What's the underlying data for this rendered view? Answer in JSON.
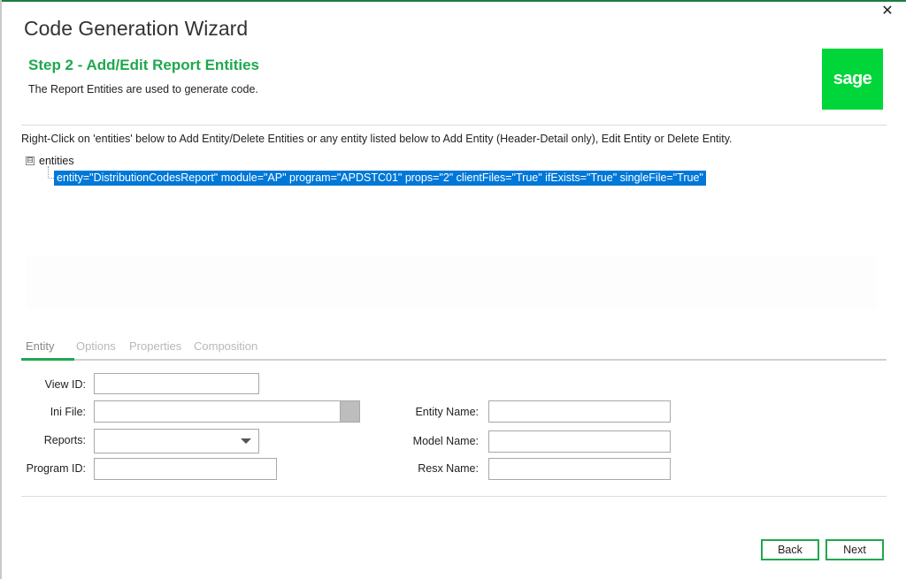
{
  "window": {
    "title": "Code Generation Wizard",
    "close_label": "✕"
  },
  "step": {
    "title": "Step  2 - Add/Edit Report Entities",
    "description": "The Report Entities are used to generate code."
  },
  "logo": {
    "text": "sage",
    "color": "#00d639"
  },
  "instruction": "Right-Click on 'entities' below to Add Entity/Delete Entities or any entity listed below to Add Entity (Header-Detail only), Edit Entity or Delete Entity.",
  "tree": {
    "expander": "⊟",
    "root_label": "entities",
    "nodes": [
      {
        "label": "entity=\"DistributionCodesReport\" module=\"AP\" program=\"APDSTC01\" props=\"2\" clientFiles=\"True\" ifExists=\"True\" singleFile=\"True\""
      }
    ]
  },
  "tabs": [
    {
      "label": "Entity",
      "active": true
    },
    {
      "label": "Options"
    },
    {
      "label": "Properties"
    },
    {
      "label": "Composition"
    }
  ],
  "form": {
    "view_id": {
      "label": "View ID:",
      "value": ""
    },
    "ini_file": {
      "label": "Ini File:",
      "value": ""
    },
    "reports": {
      "label": "Reports:",
      "value": ""
    },
    "program_id": {
      "label": "Program ID:",
      "value": ""
    },
    "entity_name": {
      "label": "Entity Name:",
      "value": ""
    },
    "model_name": {
      "label": "Model Name:",
      "value": ""
    },
    "resx_name": {
      "label": "Resx Name:",
      "value": ""
    }
  },
  "buttons": {
    "back": "Back",
    "next": "Next"
  },
  "colors": {
    "accent": "#1fa84e",
    "selection": "#0078d7"
  }
}
